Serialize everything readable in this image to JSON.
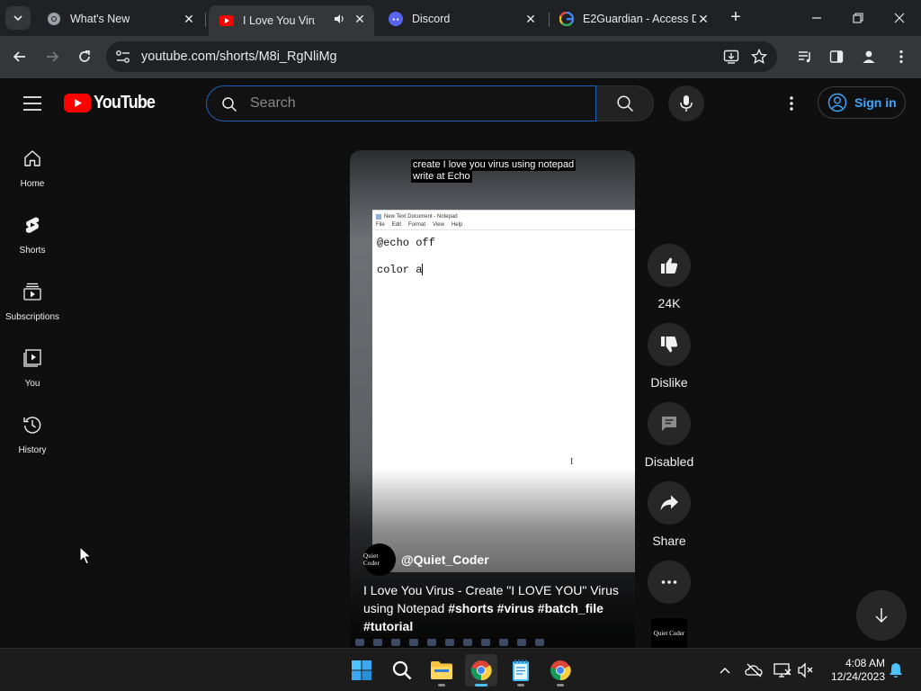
{
  "browser": {
    "tabs": [
      {
        "title": "What's New",
        "active": false
      },
      {
        "title": "I Love You Virus - (",
        "active": true,
        "audio": true
      },
      {
        "title": "Discord",
        "active": false
      },
      {
        "title": "E2Guardian - Access D",
        "active": false
      }
    ],
    "new_tab_label": "+",
    "url": "youtube.com/shorts/M8i_RgNliMg"
  },
  "youtube": {
    "logo_text": "YouTube",
    "search": {
      "placeholder": "Search",
      "value": ""
    },
    "signin_label": "Sign in",
    "guide": [
      {
        "label": "Home",
        "icon": "home-icon"
      },
      {
        "label": "Shorts",
        "icon": "shorts-icon"
      },
      {
        "label": "Subscriptions",
        "icon": "subscriptions-icon"
      },
      {
        "label": "You",
        "icon": "you-icon"
      },
      {
        "label": "History",
        "icon": "history-icon"
      }
    ],
    "short": {
      "caption_lines": [
        "create I love you virus using notepad",
        "write at Echo"
      ],
      "notepad": {
        "title": "New Text Document - Notepad",
        "menu": [
          "File",
          "Edit",
          "Format",
          "View",
          "Help"
        ],
        "lines": [
          "@echo off",
          "",
          "color a"
        ]
      },
      "channel_avatar_text": "Quiet Coder",
      "channel_handle": "@Quiet_Coder",
      "title_plain": "I Love You Virus - Create \"I LOVE YOU\" Virus using Notepad ",
      "hashtags": [
        "#shorts",
        "#virus",
        "#batch_file",
        "#tutorial"
      ]
    },
    "actions": {
      "like_count": "24K",
      "dislike_label": "Dislike",
      "comments_label": "Disabled",
      "share_label": "Share"
    },
    "rail_avatar_text": "Quiet Coder"
  },
  "taskbar": {
    "apps": [
      "start",
      "search",
      "file-explorer",
      "chrome",
      "notepad",
      "chrome"
    ],
    "clock": {
      "time": "4:08 AM",
      "date": "12/24/2023"
    }
  },
  "colors": {
    "yt_red": "#ff0000",
    "link_blue": "#3ea6ff",
    "search_focus": "#1c62b9",
    "taskbar_accent": "#4cc2ff"
  }
}
